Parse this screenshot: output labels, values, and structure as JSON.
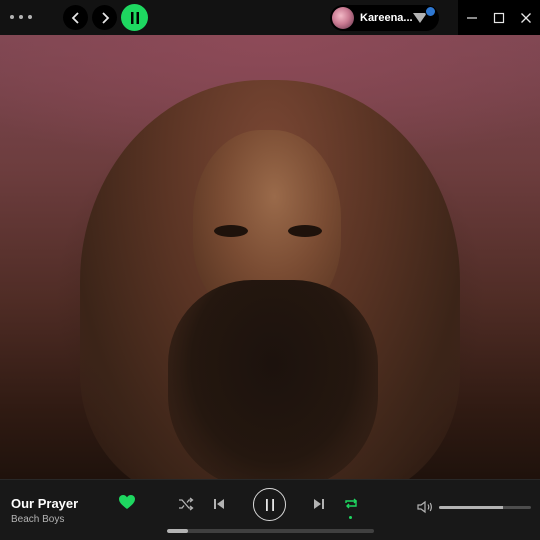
{
  "titlebar": {
    "menu_icon": "more-dots-icon",
    "back_icon": "chevron-left-icon",
    "forward_icon": "chevron-right-icon",
    "spotify_icon": "pause-bars-icon",
    "user": {
      "name": "Kareena...",
      "avatar_icon": "avatar-image",
      "menu_icon": "chevron-down-icon",
      "notification_color": "#2e77d0"
    },
    "window_controls": [
      "minimize-icon",
      "maximize-icon",
      "close-icon"
    ]
  },
  "player": {
    "track_title": "Our Prayer",
    "track_artist": "Beach Boys",
    "liked": true,
    "accent_color": "#1ed760",
    "controls": [
      "shuffle-icon",
      "previous-icon",
      "pause-icon",
      "next-icon",
      "repeat-icon"
    ],
    "repeat_active": true,
    "progress_fraction": 0.1,
    "volume_fraction": 0.7
  }
}
